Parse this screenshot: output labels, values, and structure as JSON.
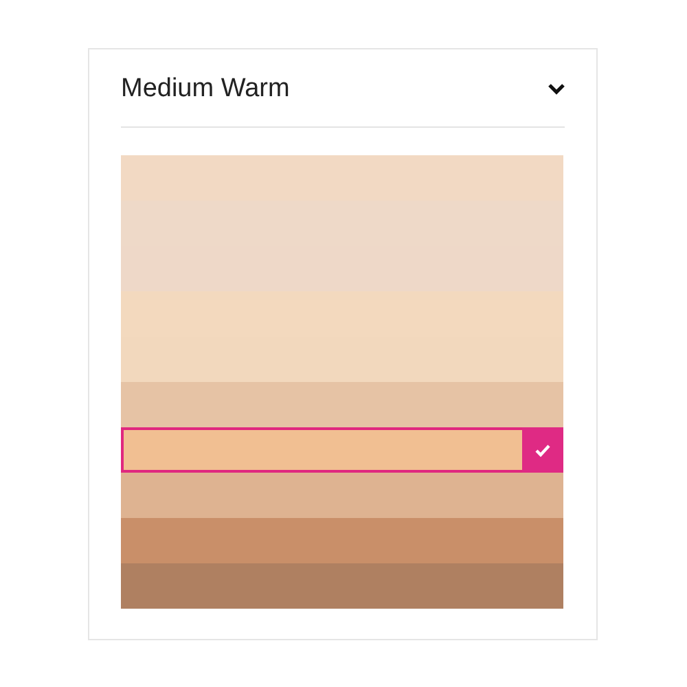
{
  "dropdown": {
    "label": "Medium Warm"
  },
  "swatches": [
    {
      "color": "#f2d9c3",
      "selected": false
    },
    {
      "color": "#eed9c8",
      "selected": false
    },
    {
      "color": "#eed8c8",
      "selected": false
    },
    {
      "color": "#f3d9be",
      "selected": false
    },
    {
      "color": "#f2d8bd",
      "selected": false
    },
    {
      "color": "#e6c3a5",
      "selected": false
    },
    {
      "color": "#f1bf92",
      "selected": true
    },
    {
      "color": "#deb391",
      "selected": false
    },
    {
      "color": "#c98f69",
      "selected": false
    },
    {
      "color": "#af8061",
      "selected": false
    }
  ]
}
